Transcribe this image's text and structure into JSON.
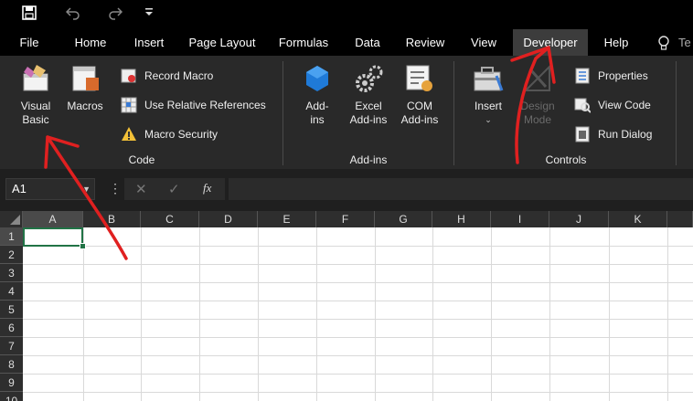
{
  "quick_access": {
    "save_icon": "save-icon",
    "undo_icon": "undo-icon",
    "redo_icon": "redo-icon",
    "customize_icon": "customize-qat-icon"
  },
  "tabs": [
    {
      "label": "File"
    },
    {
      "label": "Home"
    },
    {
      "label": "Insert"
    },
    {
      "label": "Page Layout"
    },
    {
      "label": "Formulas"
    },
    {
      "label": "Data"
    },
    {
      "label": "Review"
    },
    {
      "label": "View"
    },
    {
      "label": "Developer"
    },
    {
      "label": "Help"
    }
  ],
  "tell_me": {
    "partial_text": "Te"
  },
  "ribbon": {
    "code": {
      "group_label": "Code",
      "visual_basic_line1": "Visual",
      "visual_basic_line2": "Basic",
      "macros": "Macros",
      "record_macro": "Record Macro",
      "use_relative_references": "Use Relative References",
      "macro_security": "Macro Security"
    },
    "addins": {
      "group_label": "Add-ins",
      "addins_line1": "Add-",
      "addins_line2": "ins",
      "excel_addins_line1": "Excel",
      "excel_addins_line2": "Add-ins",
      "com_addins_line1": "COM",
      "com_addins_line2": "Add-ins"
    },
    "controls": {
      "group_label": "Controls",
      "insert": "Insert",
      "design_mode_line1": "Design",
      "design_mode_line2": "Mode",
      "properties": "Properties",
      "view_code": "View Code",
      "run_dialog": "Run Dialog"
    }
  },
  "formula_bar": {
    "name_box": "A1",
    "fx_label": "fx",
    "formula": ""
  },
  "sheet": {
    "columns": [
      "A",
      "B",
      "C",
      "D",
      "E",
      "F",
      "G",
      "H",
      "I",
      "J",
      "K"
    ],
    "rows": [
      "1",
      "2",
      "3",
      "4",
      "5",
      "6",
      "7",
      "8",
      "9",
      "10"
    ]
  },
  "colors": {
    "accent": "#217346",
    "annotation": "#e02020"
  }
}
